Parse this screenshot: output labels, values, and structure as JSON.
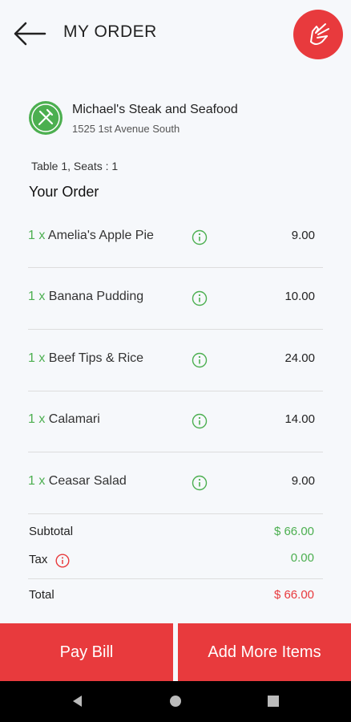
{
  "header": {
    "title": "MY ORDER"
  },
  "restaurant": {
    "name": "Michael's Steak and Seafood",
    "address": "1525 1st Avenue South"
  },
  "table_info": "Table 1, Seats : 1",
  "your_order_label": "Your Order",
  "items": [
    {
      "qty": "1 x",
      "name": "Amelia's Apple Pie",
      "price": "9.00"
    },
    {
      "qty": "1 x",
      "name": "Banana Pudding",
      "price": "10.00"
    },
    {
      "qty": "1 x",
      "name": "Beef Tips & Rice",
      "price": "24.00"
    },
    {
      "qty": "1 x",
      "name": "Calamari",
      "price": "14.00"
    },
    {
      "qty": "1 x",
      "name": "Ceasar Salad",
      "price": "9.00"
    }
  ],
  "summary": {
    "subtotal_label": "Subtotal",
    "subtotal_value": "$ 66.00",
    "tax_label": "Tax",
    "tax_value": "0.00",
    "total_label": "Total",
    "total_value": "$ 66.00"
  },
  "buttons": {
    "pay_bill": "Pay Bill",
    "add_more": "Add More Items"
  },
  "colors": {
    "accent": "#e83a3d",
    "green": "#4caf50",
    "background": "#f6f8fb"
  }
}
